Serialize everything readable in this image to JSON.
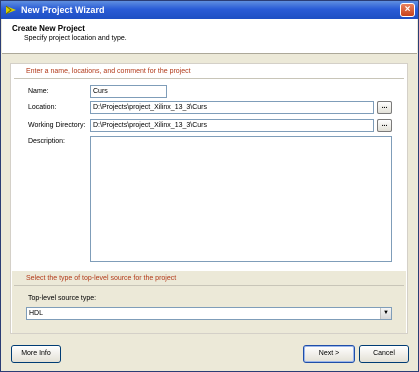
{
  "window": {
    "title": "New Project Wizard",
    "close_label": "×"
  },
  "header": {
    "title": "Create New Project",
    "subtitle": "Specify project location and type."
  },
  "project_section": {
    "heading": "Enter a name, locations, and comment for the project",
    "name_label": "Name:",
    "name_value": "Curs",
    "location_label": "Location:",
    "location_value": "D:\\Projects\\project_Xilinx_13_3\\Curs",
    "workdir_label": "Working Directory:",
    "workdir_value": "D:\\Projects\\project_Xilinx_13_3\\Curs",
    "description_label": "Description:",
    "browse_label": "..."
  },
  "source_section": {
    "heading": "Select the type of top-level source for the project",
    "type_label": "Top-level source type:",
    "type_value": "HDL"
  },
  "buttons": {
    "more_info": "More Info",
    "next": "Next >",
    "cancel": "Cancel"
  },
  "icons": {
    "app": "xilinx-logo-icon",
    "dropdown": "chevron-down-icon"
  }
}
